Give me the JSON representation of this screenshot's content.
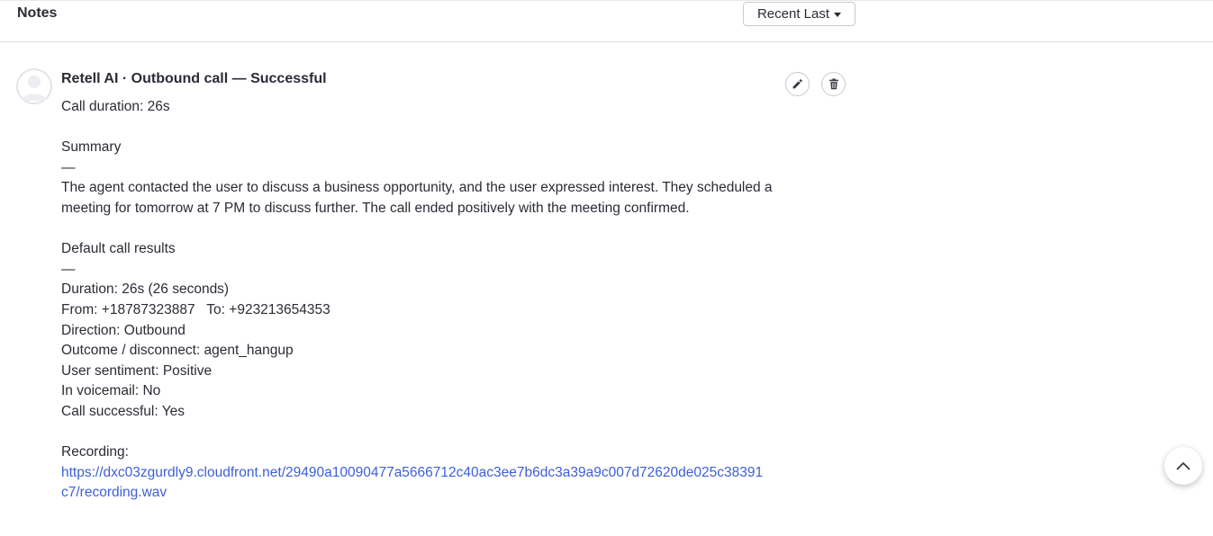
{
  "header": {
    "title": "Notes",
    "sort_label": "Recent Last",
    "sort_icon": "caret-down-icon"
  },
  "note": {
    "avatar_icon": "user-avatar-icon",
    "title": "Retell AI · Outbound call — Successful",
    "edit_icon": "pencil-icon",
    "delete_icon": "trash-icon",
    "call_duration": "Call duration: 26s",
    "summary_heading": "Summary",
    "summary_rule": "—",
    "summary_text": "The agent contacted the user to discuss a business opportunity, and the user expressed interest. They scheduled a meeting for tomorrow at 7 PM to discuss further. The call ended positively with the meeting confirmed.",
    "results_heading": "Default call results",
    "results_rule": "—",
    "results_lines": [
      "Duration: 26s (26 seconds)",
      "From: +18787323887   To: +923213654353",
      "Direction: Outbound",
      "Outcome / disconnect: agent_hangup",
      "User sentiment: Positive",
      "In voicemail: No",
      "Call successful: Yes"
    ],
    "recording_label": "Recording:",
    "recording_url": "https://dxc03zgurdly9.cloudfront.net/29490a10090477a5666712c40ac3ee7b6dc3a39a9c007d72620de025c38391c7/recording.wav"
  },
  "scroll_top_icon": "chevron-up-icon",
  "colors": {
    "text": "#2b2b36",
    "link": "#3d5fd6",
    "border": "#c9c9d1",
    "avatar_bg": "#eceef2"
  }
}
